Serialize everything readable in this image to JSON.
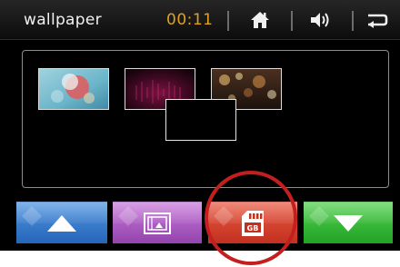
{
  "header": {
    "title": "wallpaper",
    "time": "00:11",
    "home_icon": "home-icon",
    "volume_icon": "speaker-volume-icon",
    "back_icon": "return-arrow-icon"
  },
  "gallery": {
    "thumbnails": [
      {
        "name": "wallpaper-thumbnail-1",
        "subject": "colorful-abstract-image"
      },
      {
        "name": "wallpaper-thumbnail-2",
        "subject": "dark-magenta-image"
      },
      {
        "name": "wallpaper-thumbnail-3",
        "subject": "bokeh-image"
      }
    ]
  },
  "toolbar": {
    "up_icon": "arrow-up-icon",
    "gallery_icon": "film-frame-icon",
    "sd_card_icon": "sd-card-icon",
    "sd_card_text": "GB",
    "down_icon": "arrow-down-icon"
  },
  "colors": {
    "clock": "#e0a11c",
    "blue": "#3a7fcf",
    "purple": "#b060c8",
    "red": "#d94632",
    "green": "#3cbf3c",
    "highlight": "#c41f1f"
  }
}
